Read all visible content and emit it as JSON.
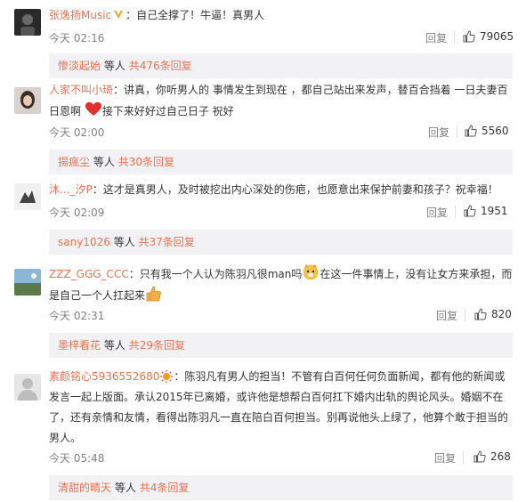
{
  "comments": [
    {
      "user": "张逸扬Music",
      "verified": true,
      "text": "：自己全撑了！牛逼！真男人",
      "time": "今天 02:16",
      "reply_label": "回复",
      "likes": "79065",
      "sub": {
        "user": "惨淡起始",
        "wait": "等人",
        "count": "共476条回复"
      }
    },
    {
      "user": "人家不叫小琦",
      "text_a": "：讲真，你听男人的  事情发生到现在  ，都自己站出来发声，替百合挡着  一日夫妻百日恩啊",
      "text_b": "接下来好好过自己日子  祝好",
      "time": "今天 02:00",
      "reply_label": "回复",
      "likes": "5560",
      "sub": {
        "user": "揚瘋尘",
        "wait": "等人",
        "count": "共30条回复"
      }
    },
    {
      "user": "沐..._汐P",
      "text": "：这才是真男人，及时被挖出内心深处的伤疤，也愿意出来保护前妻和孩子？祝幸福！",
      "time": "今天 02:09",
      "reply_label": "回复",
      "likes": "1951",
      "sub": {
        "user": "sany1026",
        "wait": "等人",
        "count": "共37条回复"
      }
    },
    {
      "user": "ZZZ_GGG_CCC",
      "text_a": "：只有我一个人认为陈羽凡很man吗",
      "text_b": "在这一件事情上，没有让女方来承担，而是自己一个人扛起来",
      "time": "今天 02:31",
      "reply_label": "回复",
      "likes": "820",
      "sub": {
        "user": "墨梓看花",
        "wait": "等人",
        "count": "共29条回复"
      }
    },
    {
      "user": "素颜铭心5936552680",
      "text": "：陈羽凡有男人的担当！不管有白百何任何负面新闻，都有他的新闻或发言一起上版面。承认2015年已离婚，或许他是想帮白百何扛下婚内出轨的舆论风头。婚姻不在了，还有亲情和友情，看得出陈羽凡一直在陪白百何担当。别再说他头上绿了，他算个敢于担当的男人。",
      "time": "今天 05:48",
      "reply_label": "回复",
      "likes": "268",
      "sub": {
        "user": "清甜的晴天",
        "wait": "等人",
        "count": "共4条回复"
      }
    }
  ],
  "colors": {
    "username": "#eb7350",
    "meta": "#808080",
    "subbox_bg": "#f2f2f5"
  },
  "icons": [
    "thumbs-up-icon",
    "verified-v-icon",
    "heart-emoji",
    "doge-emoji",
    "thumb-emoji",
    "sun-emoji"
  ]
}
